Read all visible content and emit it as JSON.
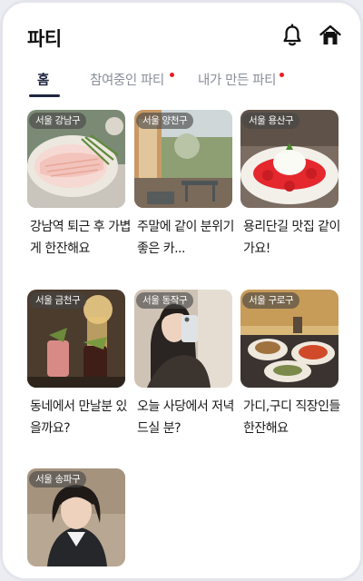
{
  "header": {
    "title": "파티",
    "bell_icon": "bell-icon",
    "home_icon": "home-icon"
  },
  "tabs": [
    {
      "label": "홈",
      "active": true,
      "has_new": false
    },
    {
      "label": "참여중인 파티",
      "active": false,
      "has_new": true
    },
    {
      "label": "내가 만든 파티",
      "active": false,
      "has_new": true
    }
  ],
  "colors": {
    "accent": "#1f2540",
    "notification_dot": "#ee1c25"
  },
  "parties": [
    {
      "location": "서울 강남구",
      "title": "강남역 퇴근 후 가볍게 한잔해요"
    },
    {
      "location": "서울 양천구",
      "title": "주말에 같이 분위기 좋은 카..."
    },
    {
      "location": "서울 용산구",
      "title": "용리단길 맛집 같이가요!"
    },
    {
      "location": "서울 금천구",
      "title": "동네에서 만날분 있을까요?"
    },
    {
      "location": "서울 동작구",
      "title": "오늘 사당에서 저녁 드실 분?"
    },
    {
      "location": "서울 구로구",
      "title": "가디,구디 직장인들 한잔해요"
    },
    {
      "location": "서울 송파구",
      "title": ""
    }
  ]
}
